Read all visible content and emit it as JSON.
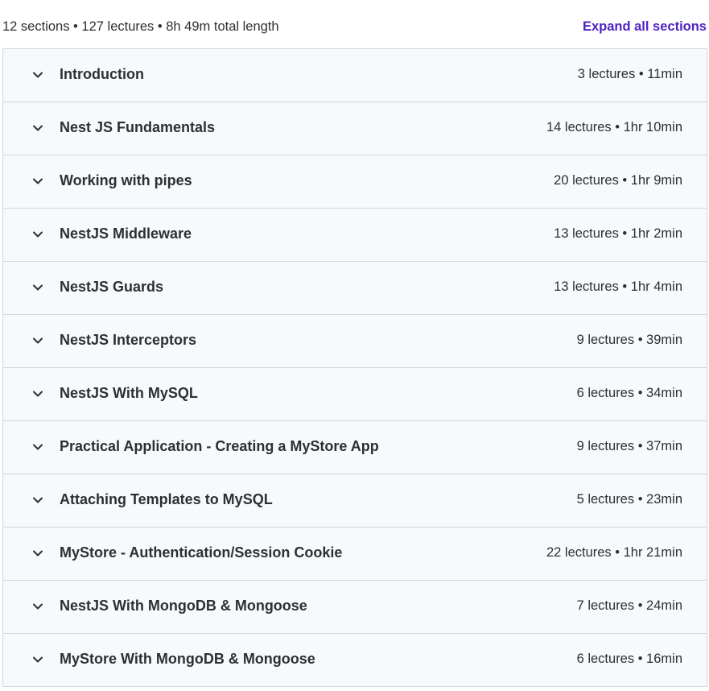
{
  "summary": {
    "text": "12 sections • 127 lectures • 8h 49m total length",
    "expand_label": "Expand all sections"
  },
  "sections": [
    {
      "title": "Introduction",
      "meta": "3 lectures • 11min"
    },
    {
      "title": "Nest JS Fundamentals",
      "meta": "14 lectures • 1hr 10min"
    },
    {
      "title": "Working with pipes",
      "meta": "20 lectures • 1hr 9min"
    },
    {
      "title": "NestJS Middleware",
      "meta": "13 lectures • 1hr 2min"
    },
    {
      "title": "NestJS Guards",
      "meta": "13 lectures • 1hr 4min"
    },
    {
      "title": "NestJS Interceptors",
      "meta": "9 lectures • 39min"
    },
    {
      "title": "NestJS With MySQL",
      "meta": "6 lectures • 34min"
    },
    {
      "title": "Practical Application - Creating a MyStore App",
      "meta": "9 lectures • 37min"
    },
    {
      "title": "Attaching Templates to MySQL",
      "meta": "5 lectures • 23min"
    },
    {
      "title": "MyStore - Authentication/Session Cookie",
      "meta": "22 lectures • 1hr 21min"
    },
    {
      "title": "NestJS With MongoDB & Mongoose",
      "meta": "7 lectures • 24min"
    },
    {
      "title": "MyStore With MongoDB & Mongoose",
      "meta": "6 lectures • 16min"
    }
  ],
  "icons": {
    "section_toggle": "chevron-down-icon"
  }
}
